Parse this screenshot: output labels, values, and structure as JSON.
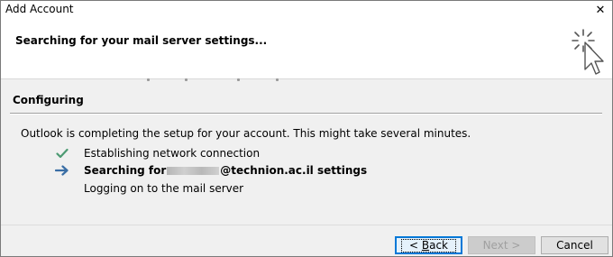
{
  "window": {
    "title": "Add Account",
    "close_glyph": "✕"
  },
  "header": {
    "title": "Searching for your mail server settings..."
  },
  "section": {
    "title": "Configuring",
    "intro": "Outlook is completing the setup for your account. This might take several minutes."
  },
  "steps": [
    {
      "icon": "checkmark-icon",
      "status": "done",
      "label": "Establishing network connection"
    },
    {
      "icon": "arrow-right-icon",
      "status": "current",
      "label_prefix": "Searching for",
      "label_suffix": "@technion.ac.il settings"
    },
    {
      "icon": "none",
      "status": "pending",
      "label": "Logging on to the mail server"
    }
  ],
  "buttons": {
    "back": {
      "mnemonic": "B",
      "rest": "ack",
      "prefix": "< ",
      "enabled": true
    },
    "next": {
      "label": "Next >",
      "enabled": false
    },
    "cancel": {
      "label": "Cancel",
      "enabled": true
    }
  },
  "colors": {
    "check": "#4c9a72",
    "arrow": "#3a6ea5",
    "focus_border": "#0078d7"
  }
}
